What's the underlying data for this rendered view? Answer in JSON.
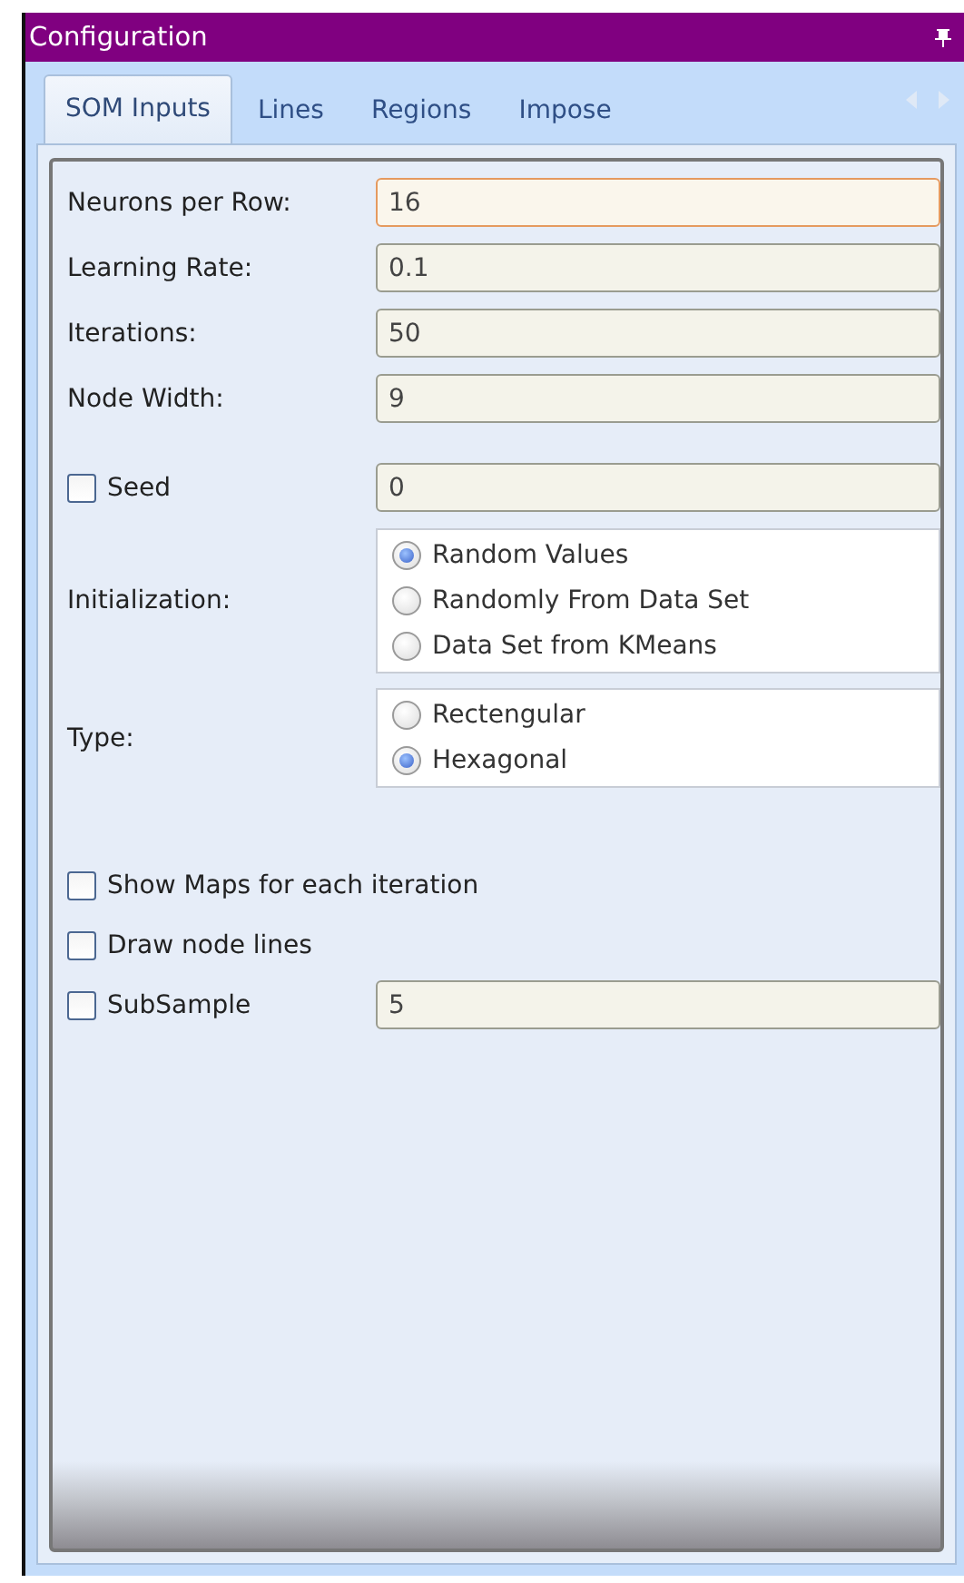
{
  "window": {
    "title": "Configuration"
  },
  "tabs": [
    {
      "label": "SOM Inputs",
      "selected": true
    },
    {
      "label": "Lines",
      "selected": false
    },
    {
      "label": "Regions",
      "selected": false
    },
    {
      "label": "Impose",
      "selected": false
    }
  ],
  "rows": [
    {
      "kind": "text",
      "label": "Neurons per Row:",
      "value": "16",
      "focused": true
    },
    {
      "kind": "text",
      "label": "Learning Rate:",
      "value": "0.1",
      "focused": false
    },
    {
      "kind": "text",
      "label": "Iterations:",
      "value": "50",
      "focused": false
    },
    {
      "kind": "text",
      "label": "Node Width:",
      "value": "9",
      "focused": false
    },
    {
      "kind": "check_text",
      "label": "Seed",
      "checked": false,
      "value": "0"
    },
    {
      "kind": "radio_group",
      "label": "Initialization:",
      "options": [
        {
          "label": "Random Values",
          "selected": true
        },
        {
          "label": "Randomly From Data Set",
          "selected": false
        },
        {
          "label": "Data Set from KMeans",
          "selected": false
        }
      ]
    },
    {
      "kind": "radio_group",
      "label": "Type:",
      "options": [
        {
          "label": "Rectengular",
          "selected": false
        },
        {
          "label": "Hexagonal",
          "selected": true
        }
      ]
    },
    {
      "kind": "check",
      "label": "Show Maps for each iteration",
      "checked": false
    },
    {
      "kind": "check",
      "label": "Draw node lines",
      "checked": false
    },
    {
      "kind": "check_text",
      "label": "SubSample",
      "checked": false,
      "value": "5"
    }
  ]
}
